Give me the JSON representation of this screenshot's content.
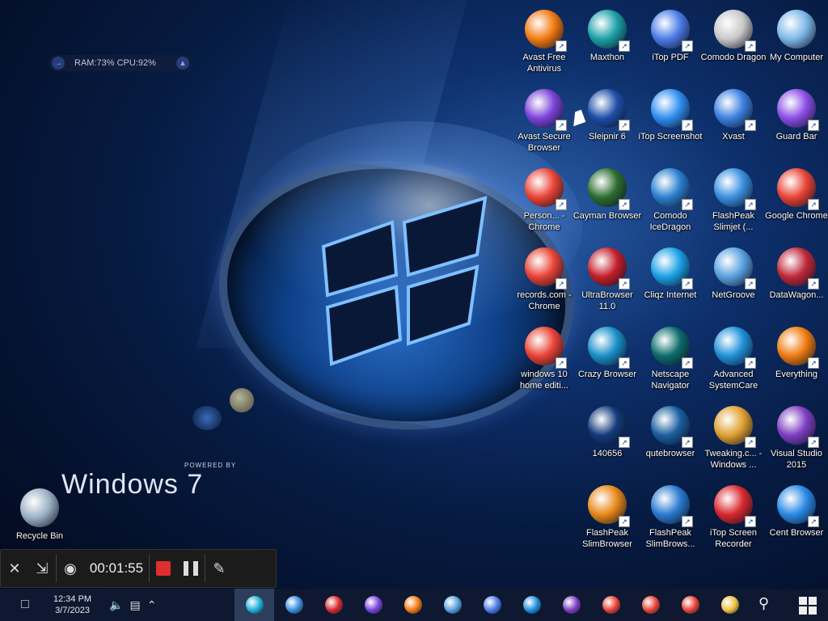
{
  "system_monitor": {
    "text": "RAM:73% CPU:92%"
  },
  "wallpaper": {
    "powered_by": "POWERED BY",
    "brand": "Windows 7"
  },
  "desktop_icons": [
    {
      "label": "My Computer",
      "icon": "computer-icon",
      "color": "#7db7e8"
    },
    {
      "label": "Comodo Dragon",
      "icon": "comodo-dragon-icon",
      "color": "#c8c8c8"
    },
    {
      "label": "iTop PDF",
      "icon": "itop-pdf-icon",
      "color": "#4c7be8"
    },
    {
      "label": "Maxthon",
      "icon": "maxthon-icon",
      "color": "#1ca0a8"
    },
    {
      "label": "Avast Free Antivirus",
      "icon": "avast-icon",
      "color": "#f27a12"
    },
    {
      "label": "Guard Bar",
      "icon": "guard-bar-icon",
      "color": "#8a4de6"
    },
    {
      "label": "Xvast",
      "icon": "xvast-icon",
      "color": "#3b7fe0"
    },
    {
      "label": "iTop Screenshot",
      "icon": "itop-screenshot-icon",
      "color": "#2e8ef0"
    },
    {
      "label": "Sleipnir 6",
      "icon": "sleipnir-icon",
      "color": "#1d4ea8"
    },
    {
      "label": "Avast Secure Browser",
      "icon": "avast-secure-icon",
      "color": "#7b42d9"
    },
    {
      "label": "Google Chrome",
      "icon": "chrome-icon",
      "color": "#e94235"
    },
    {
      "label": "FlashPeak Slimjet (...",
      "icon": "slimjet-icon",
      "color": "#3a8ee0"
    },
    {
      "label": "Comodo IceDragon",
      "icon": "icedragon-icon",
      "color": "#2a7fd0"
    },
    {
      "label": "Cayman Browser",
      "icon": "cayman-icon",
      "color": "#2c6c30"
    },
    {
      "label": "Person... - Chrome",
      "icon": "chrome-profile-icon",
      "color": "#e94235"
    },
    {
      "label": "DataWagon...",
      "icon": "datawagon-icon",
      "color": "#c0283a"
    },
    {
      "label": "NetGroove",
      "icon": "netgroove-icon",
      "color": "#5aa0e0"
    },
    {
      "label": "Cliqz Internet",
      "icon": "cliqz-icon",
      "color": "#1aa0e6"
    },
    {
      "label": "UltraBrowser 11.0",
      "icon": "ultrabrowser-icon",
      "color": "#c41e2b"
    },
    {
      "label": "records.com - Chrome",
      "icon": "chrome-records-icon",
      "color": "#e94235"
    },
    {
      "label": "Everything",
      "icon": "everything-icon",
      "color": "#ef7b10"
    },
    {
      "label": "Advanced SystemCare",
      "icon": "systemcare-icon",
      "color": "#1e90d8"
    },
    {
      "label": "Netscape Navigator",
      "icon": "netscape-icon",
      "color": "#0c6b6b"
    },
    {
      "label": "Crazy Browser",
      "icon": "crazy-browser-icon",
      "color": "#1890c8"
    },
    {
      "label": "windows 10 home editi...",
      "icon": "chrome-win10-icon",
      "color": "#e94235"
    },
    {
      "label": "Visual Studio 2015",
      "icon": "visual-studio-icon",
      "color": "#7d3fc2"
    },
    {
      "label": "Tweaking.c... - Windows ...",
      "icon": "tweaking-icon",
      "color": "#e0a030"
    },
    {
      "label": "qutebrowser",
      "icon": "qutebrowser-icon",
      "color": "#1a5fa0"
    },
    {
      "label": "140656",
      "icon": "image-file-icon",
      "color": "#123a7a"
    },
    {
      "label": "Cent Browser",
      "icon": "cent-browser-icon",
      "color": "#2a8ae6"
    },
    {
      "label": "iTop Screen Recorder",
      "icon": "itop-recorder-icon",
      "color": "#d8282e"
    },
    {
      "label": "FlashPeak SlimBrows...",
      "icon": "slimbrowser-icon",
      "color": "#2a7ad0"
    },
    {
      "label": "FlashPeak SlimBrowser",
      "icon": "slimbrowser-orange-icon",
      "color": "#e88818"
    },
    {
      "label": "Recycle Bin",
      "icon": "recycle-bin-icon",
      "color": "#9ab0c4"
    }
  ],
  "recorder": {
    "time": "00:01:55",
    "close_icon": "close-icon",
    "minimize_icon": "minimize-icon",
    "camera_icon": "camera-icon",
    "stop_icon": "stop-icon",
    "pause_icon": "pause-icon",
    "pen_icon": "pen-icon"
  },
  "taskbar": {
    "clock_time": "12:34 PM",
    "clock_date": "3/7/2023",
    "apps": [
      {
        "name": "edge",
        "color": "#1fb0d8",
        "active": true
      },
      {
        "name": "slimjet",
        "color": "#3a8ee0",
        "active": false
      },
      {
        "name": "itop-recorder",
        "color": "#d8282e",
        "active": false
      },
      {
        "name": "avast-secure",
        "color": "#7b42d9",
        "active": false
      },
      {
        "name": "avast",
        "color": "#f27a12",
        "active": false
      },
      {
        "name": "netgroove",
        "color": "#5aa0e0",
        "active": false
      },
      {
        "name": "itop-pdf",
        "color": "#4c7be8",
        "active": false
      },
      {
        "name": "systemcare",
        "color": "#1e90d8",
        "active": false
      },
      {
        "name": "visual-studio",
        "color": "#7d3fc2",
        "active": false
      },
      {
        "name": "chrome-1",
        "color": "#e94235",
        "active": false
      },
      {
        "name": "chrome-2",
        "color": "#e94235",
        "active": false
      },
      {
        "name": "chrome-3",
        "color": "#e94235",
        "active": false
      },
      {
        "name": "file-explorer",
        "color": "#f0c040",
        "active": false
      }
    ]
  }
}
